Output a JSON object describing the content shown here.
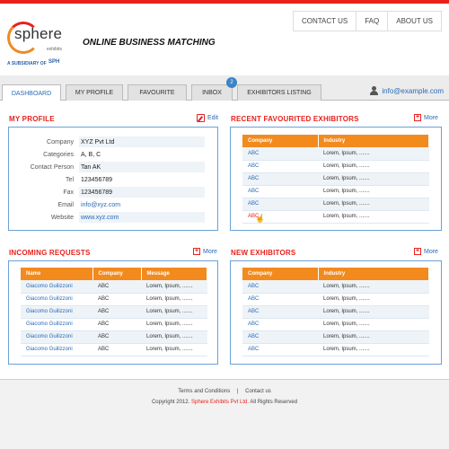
{
  "brand": {
    "logo_word": "sphere",
    "logo_sub": "exhibits",
    "subsidiary": "A SUBSIDIARY OF",
    "subsidiary_mark": "SPH",
    "tagline": "ONLINE BUSINESS MATCHING"
  },
  "topnav": [
    "CONTACT US",
    "FAQ",
    "ABOUT US"
  ],
  "tabs": [
    {
      "label": "DASHBOARD",
      "active": true
    },
    {
      "label": "MY PROFILE"
    },
    {
      "label": "FAVOURITE"
    },
    {
      "label": "INBOX",
      "badge": "2"
    },
    {
      "label": "EXHIBITORS LISTING"
    }
  ],
  "user": {
    "email": "info@example.com"
  },
  "my_profile": {
    "title": "MY PROFILE",
    "action": "Edit",
    "rows": [
      {
        "label": "Company",
        "value": "XYZ Pvt Ltd"
      },
      {
        "label": "Categories",
        "value": "A, B, C"
      },
      {
        "label": "Contact Person",
        "value": "Tan AK"
      },
      {
        "label": "Tel",
        "value": "123456789"
      },
      {
        "label": "Fax",
        "value": "123456789"
      },
      {
        "label": "Email",
        "value": "info@xyz.com"
      },
      {
        "label": "Website",
        "value": "www.xyz.com"
      }
    ]
  },
  "recent_favourited": {
    "title": "RECENT FAVOURITED EXHIBITORS",
    "action": "More",
    "columns": [
      "Company",
      "Industry"
    ],
    "rows": [
      [
        "ABC",
        "Lorem, Ipsum, ......."
      ],
      [
        "ABC",
        "Lorem, Ipsum, ......."
      ],
      [
        "ABC",
        "Lorem, Ipsum, ......."
      ],
      [
        "ABC",
        "Lorem, Ipsum, ......."
      ],
      [
        "ABC",
        "Lorem, Ipsum, ......."
      ],
      [
        "ABC",
        "Lorem, Ipsum, ......."
      ]
    ]
  },
  "incoming_requests": {
    "title": "INCOMING REQUESTS",
    "action": "More",
    "columns": [
      "Name",
      "Company",
      "Message"
    ],
    "rows": [
      [
        "Giacomo Guilizzoni",
        "ABC",
        "Lorem, Ipsum, ......."
      ],
      [
        "Giacomo Guilizzoni",
        "ABC",
        "Lorem, Ipsum, ......."
      ],
      [
        "Giacomo Guilizzoni",
        "ABC",
        "Lorem, Ipsum, ......."
      ],
      [
        "Giacomo Guilizzoni",
        "ABC",
        "Lorem, Ipsum, ......."
      ],
      [
        "Giacomo Guilizzoni",
        "ABC",
        "Lorem, Ipsum, ......."
      ],
      [
        "Giacomo Guilizzoni",
        "ABC",
        "Lorem, Ipsum, ......."
      ]
    ]
  },
  "new_exhibitors": {
    "title": "NEW EXHIBITORS",
    "action": "More",
    "columns": [
      "Company",
      "Industry"
    ],
    "rows": [
      [
        "ABC",
        "Lorem, Ipsum, ......."
      ],
      [
        "ABC",
        "Lorem, Ipsum, ......."
      ],
      [
        "ABC",
        "Lorem, Ipsum, ......."
      ],
      [
        "ABC",
        "Lorem, Ipsum, ......."
      ],
      [
        "ABC",
        "Lorem, Ipsum, ......."
      ],
      [
        "ABC",
        "Lorem, Ipsum, ......."
      ]
    ]
  },
  "footer": {
    "links": [
      "Terms and Conditions",
      "Contact us"
    ],
    "separator": "|",
    "copyright_prefix": "Copyright 2012.",
    "company": "Sphere Exhibits Pvt Ltd.",
    "rights": "All Rights Reserved"
  },
  "colors": {
    "accent_red": "#e8211d",
    "header_orange": "#f28a1e",
    "link_blue": "#2a6ab5",
    "panel_border": "#6aa1d8"
  },
  "icons": [
    "user-icon",
    "edit-icon",
    "plus-icon",
    "pointer-cursor-icon"
  ]
}
